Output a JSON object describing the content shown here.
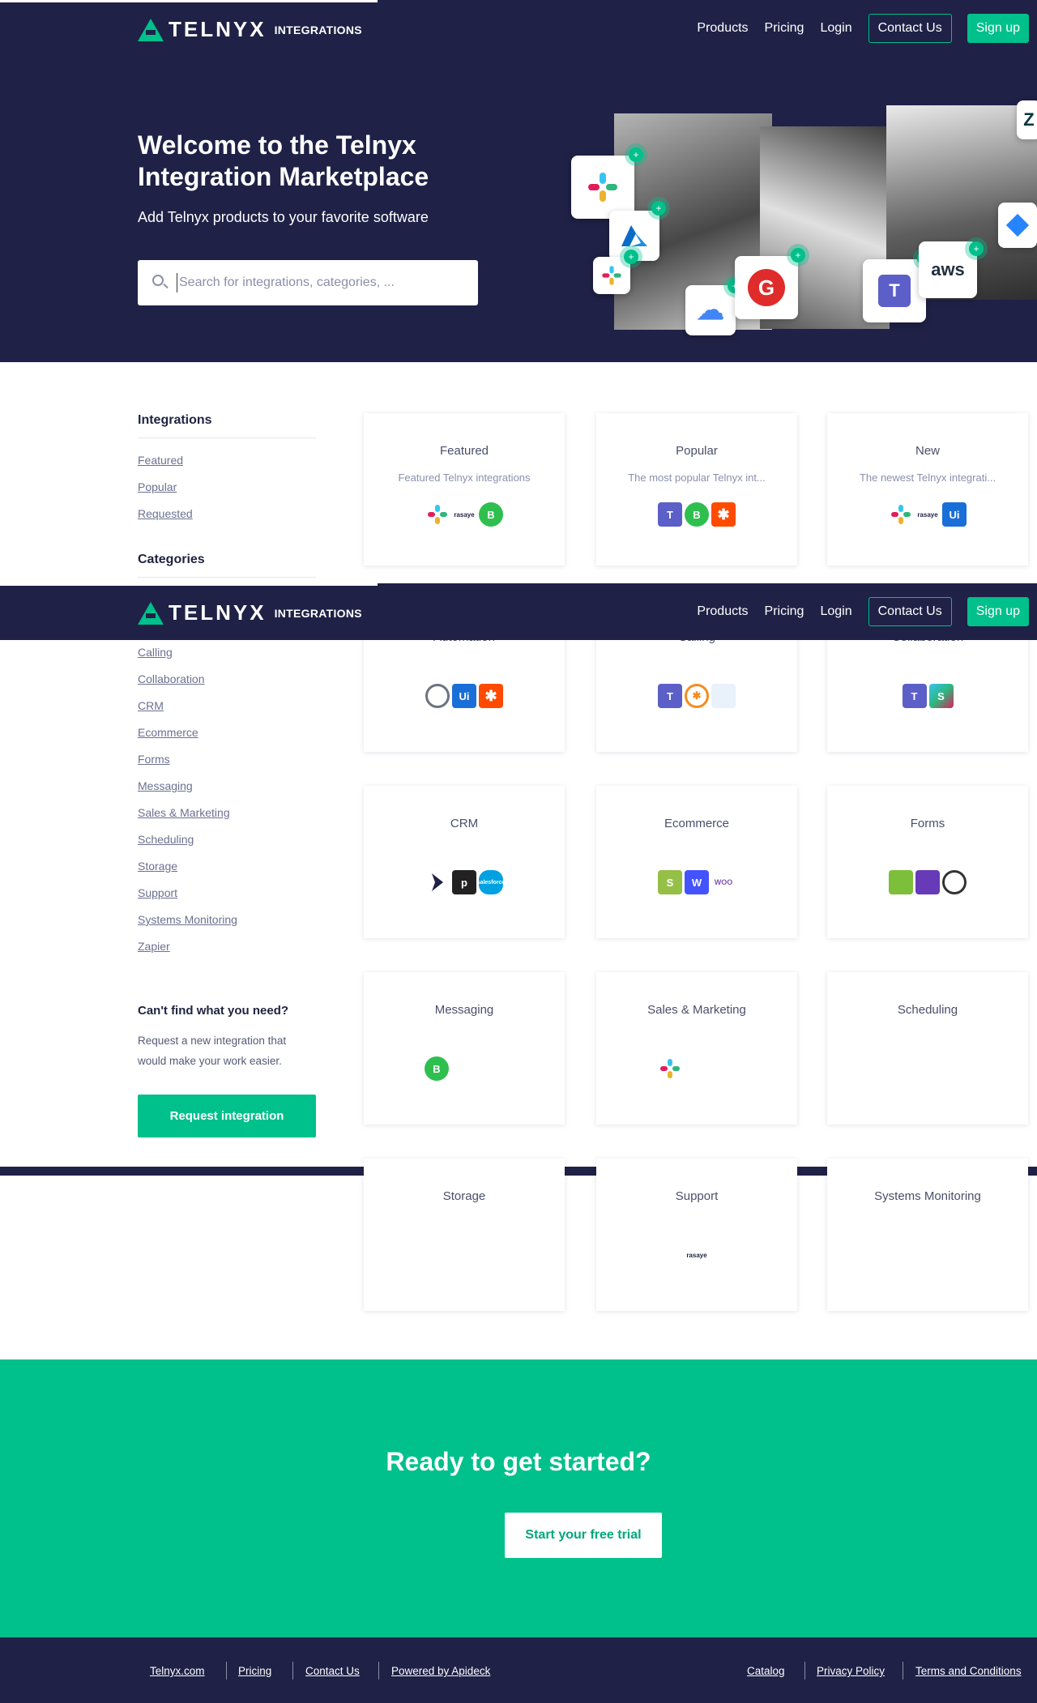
{
  "header": {
    "brand": "TELNYX",
    "brand_sub": "INTEGRATIONS",
    "nav": [
      "Products",
      "Pricing",
      "Login"
    ],
    "contact_label": "Contact Us",
    "signup_label": "Sign up"
  },
  "hero": {
    "title": "Welcome to the Telnyx Integration Marketplace",
    "subtitle": "Add Telnyx products to your favorite software",
    "search_placeholder": "Search for integrations, categories, ..."
  },
  "sidebar": {
    "integrations_heading": "Integrations",
    "integrations": [
      "Featured",
      "Popular",
      "Requested"
    ],
    "categories_heading": "Categories",
    "categories": [
      "Calling",
      "Collaboration",
      "CRM",
      "Ecommerce",
      "Forms",
      "Messaging",
      "Sales & Marketing",
      "Scheduling",
      "Storage",
      "Support",
      "Systems Monitoring",
      "Zapier"
    ],
    "cta_heading": "Can't find what you need?",
    "cta_text_line1": "Request a new integration that",
    "cta_text_line2": "would make your work easier.",
    "cta_button": "Request integration"
  },
  "cards": {
    "featured": {
      "title": "Featured",
      "desc": "Featured Telnyx integrations",
      "icons": [
        "slack-icon",
        "rasaye-icon",
        "whatsapp-business-icon"
      ]
    },
    "popular": {
      "title": "Popular",
      "desc": "The most popular Telnyx int...",
      "icons": [
        "teams-icon",
        "whatsapp-business-icon",
        "zapier-icon"
      ]
    },
    "new": {
      "title": "New",
      "desc": "The newest Telnyx integrati...",
      "icons": [
        "slack-icon",
        "rasaye-icon",
        "uipath-icon"
      ]
    },
    "automation": {
      "title": "Automation",
      "icons": [
        "integromat-icon",
        "uipath-icon",
        "zapier-icon"
      ]
    },
    "calling": {
      "title": "Calling",
      "icons": [
        "teams-icon",
        "asterisk-icon",
        "other-calling-icon"
      ]
    },
    "collaboration": {
      "title": "Collaboration",
      "icons": [
        "teams-icon",
        "slack-icon"
      ]
    },
    "crm": {
      "title": "CRM",
      "icons": [
        "dynamics-icon",
        "pipedrive-icon",
        "salesforce-icon"
      ]
    },
    "ecommerce": {
      "title": "Ecommerce",
      "icons": [
        "shopify-icon",
        "webflow-icon",
        "woocommerce-icon"
      ]
    },
    "forms": {
      "title": "Forms",
      "icons": [
        "sheets-icon",
        "forms-icon",
        "gravity-forms-icon"
      ]
    },
    "messaging": {
      "title": "Messaging",
      "icons": [
        "whatsapp-business-icon"
      ]
    },
    "sales_marketing": {
      "title": "Sales & Marketing",
      "icons": [
        "slack-icon"
      ]
    },
    "scheduling": {
      "title": "Scheduling",
      "icons": []
    },
    "storage": {
      "title": "Storage",
      "icons": []
    },
    "support": {
      "title": "Support",
      "icons": [
        "rasaye-icon"
      ]
    },
    "systems_monitoring": {
      "title": "Systems Monitoring",
      "icons": []
    }
  },
  "icon_text": {
    "uipath": "Ui",
    "whatsapp": "B",
    "zapier": "✱",
    "teams": "T",
    "pipedrive": "p",
    "webflow": "W",
    "shopify": "S",
    "rasaye": "rasaye",
    "salesforce": "salesforce",
    "woo": "WOO",
    "gcloud": "☁",
    "g": "G",
    "aws": "aws",
    "z": "Z",
    "plus": "+"
  },
  "band": {
    "heading": "Ready to get started?",
    "button": "Start your free trial"
  },
  "footer": {
    "left": [
      "Telnyx.com",
      "Pricing",
      "Contact Us",
      "Powered by Apideck"
    ],
    "right": [
      "Catalog",
      "Privacy Policy",
      "Terms and Conditions"
    ]
  },
  "colors": {
    "navy": "#1f2146",
    "green": "#00c08b"
  }
}
